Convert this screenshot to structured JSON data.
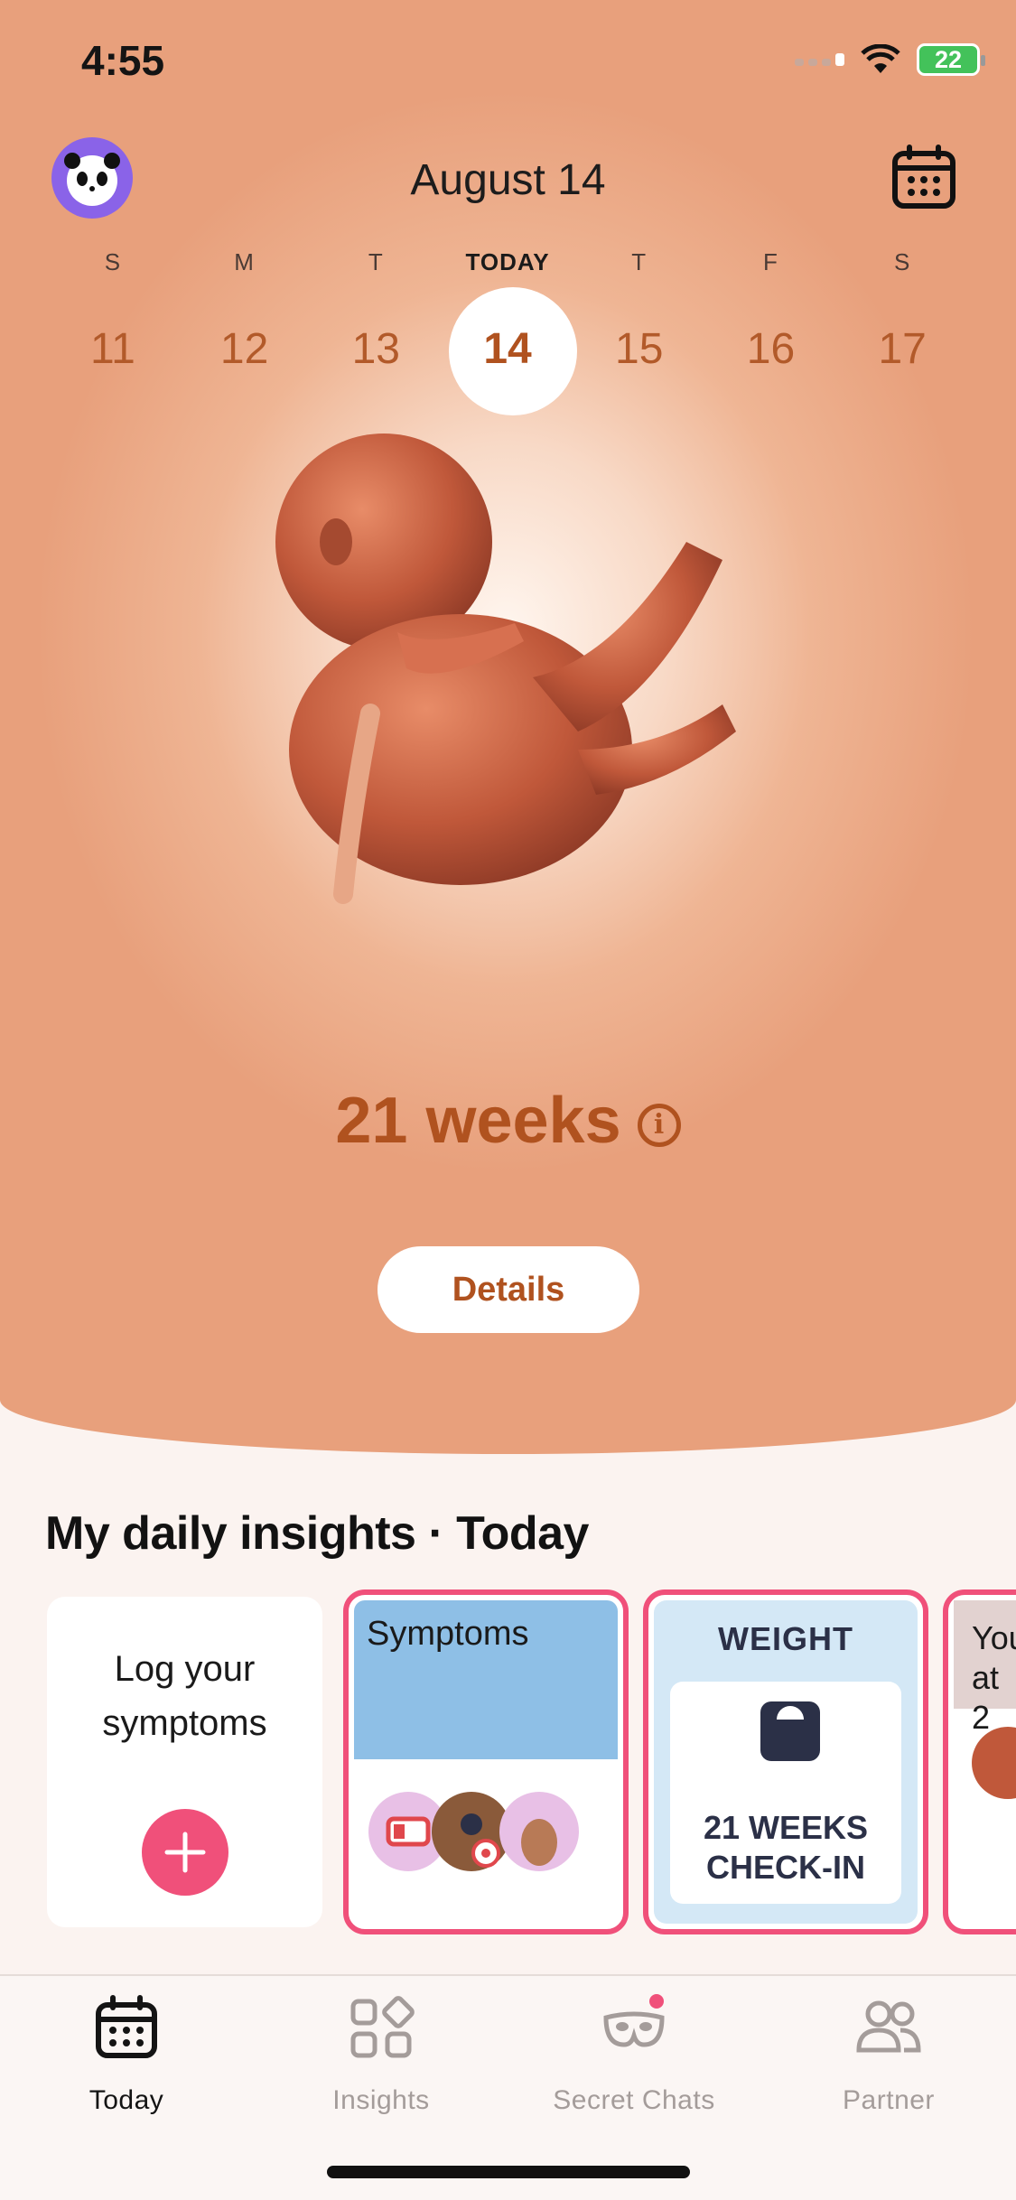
{
  "status_bar": {
    "time": "4:55",
    "battery": "22"
  },
  "header": {
    "date_title": "August 14"
  },
  "week": [
    {
      "letter": "S",
      "number": "11",
      "today": false
    },
    {
      "letter": "M",
      "number": "12",
      "today": false
    },
    {
      "letter": "T",
      "number": "13",
      "today": false
    },
    {
      "letter": "TODAY",
      "number": "14",
      "today": true
    },
    {
      "letter": "T",
      "number": "15",
      "today": false
    },
    {
      "letter": "F",
      "number": "16",
      "today": false
    },
    {
      "letter": "S",
      "number": "17",
      "today": false
    }
  ],
  "hero": {
    "weeks_label": "21 weeks",
    "info_glyph": "i",
    "details_button": "Details"
  },
  "insights": {
    "title": "My daily insights · Today",
    "log_card": {
      "label": "Log your symptoms"
    },
    "symptoms_card": {
      "label": "Symptoms"
    },
    "weight_card": {
      "title": "WEIGHT",
      "line1": "21 WEEKS",
      "line2": "CHECK-IN"
    },
    "partial_card": {
      "label": "You at 2"
    }
  },
  "tabbar": {
    "tabs": [
      {
        "label": "Today",
        "active": true,
        "icon": "calendar-icon"
      },
      {
        "label": "Insights",
        "active": false,
        "icon": "insights-icon"
      },
      {
        "label": "Secret Chats",
        "active": false,
        "icon": "mask-icon"
      },
      {
        "label": "Partner",
        "active": false,
        "icon": "partner-icon"
      }
    ]
  },
  "colors": {
    "accent": "#b0521f",
    "pink": "#f0507a",
    "avatar_bg": "#8a63e8"
  }
}
